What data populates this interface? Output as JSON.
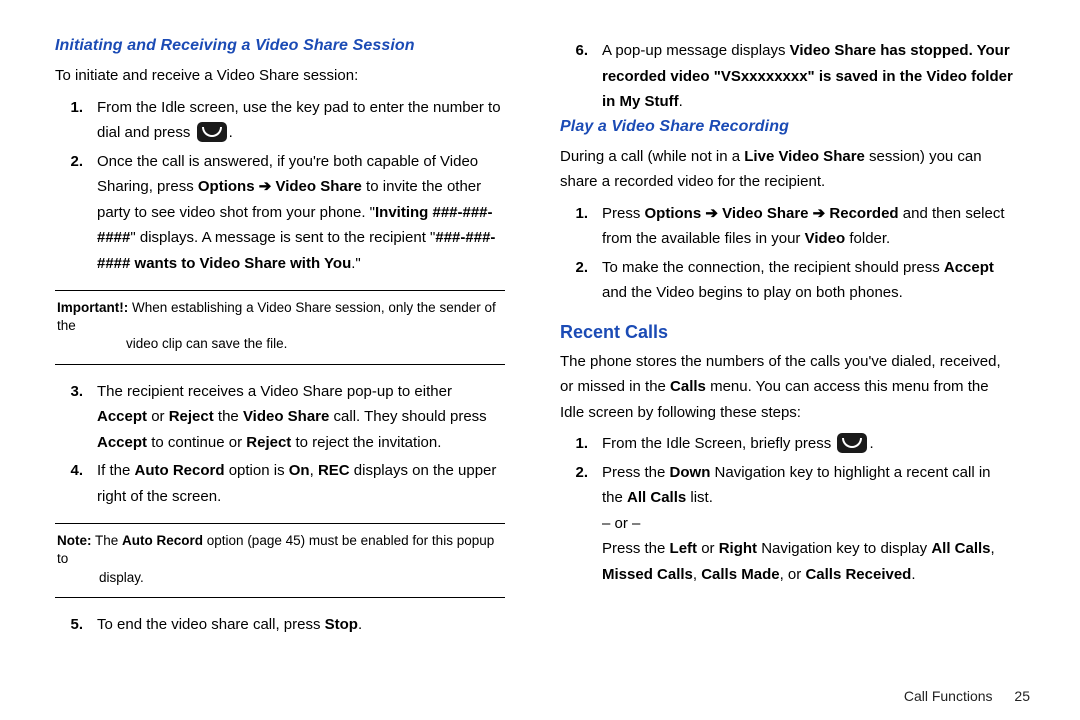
{
  "left": {
    "h_init": "Initiating and Receiving a Video Share Session",
    "intro": "To initiate and receive a Video Share session:",
    "s1_a": "From the Idle screen, use the key pad to enter the number to dial and press ",
    "s1_b": ".",
    "s2_a": "Once the call is answered, if you're both capable of Video Sharing, press ",
    "s2_b": "Options ➔ Video Share",
    "s2_c": " to invite the other party to see video shot from your phone. \"",
    "s2_d": "Inviting ###-###-####",
    "s2_e": "\" displays. A message is sent to the recipient \"",
    "s2_f": "###-###-#### wants to Video Share with You",
    "s2_g": ".\"",
    "important_label": "Important!:",
    "important_1": " When establishing a Video Share session, only the sender of the",
    "important_2": "video clip can save the file.",
    "s3_a": "The recipient receives a Video Share pop-up to either ",
    "s3_b": "Accept",
    "s3_c": " or ",
    "s3_d": "Reject",
    "s3_e": " the ",
    "s3_f": "Video Share",
    "s3_g": " call. They should press ",
    "s3_h": "Accept",
    "s3_i": " to continue or ",
    "s3_j": "Reject",
    "s3_k": " to reject the invitation.",
    "s4_a": "If the ",
    "s4_b": "Auto Record",
    "s4_c": " option is ",
    "s4_d": "On",
    "s4_e": ", ",
    "s4_f": "REC",
    "s4_g": " displays on the upper right of the screen.",
    "note_label": "Note:",
    "note_1": " The ",
    "note_1b": "Auto Record",
    "note_1c": " option (page 45) must be enabled for this popup to",
    "note_2": "display.",
    "s5_a": "To end the video share call, press ",
    "s5_b": "Stop",
    "s5_c": "."
  },
  "right": {
    "s6_a": "A pop-up message displays ",
    "s6_b": "Video Share has stopped. Your recorded video \"VSxxxxxxxx\" is saved in the Video folder in My Stuff",
    "s6_c": ".",
    "h_play": "Play a Video Share Recording",
    "play_intro_a": "During a call (while not in a ",
    "play_intro_b": "Live Video Share",
    "play_intro_c": " session) you can share a recorded video for the recipient.",
    "p1_a": "Press ",
    "p1_b": "Options ➔ Video Share ➔ Recorded",
    "p1_c": " and then select from the available files in your ",
    "p1_d": "Video",
    "p1_e": " folder.",
    "p2_a": "To make the connection, the recipient should press ",
    "p2_b": "Accept",
    "p2_c": " and the Video begins to play on both phones.",
    "h_recent": "Recent Calls",
    "recent_intro_a": "The phone stores the numbers of the calls you've dialed, received, or missed in the ",
    "recent_intro_b": "Calls",
    "recent_intro_c": " menu. You can access this menu from the Idle screen by following these steps:",
    "r1_a": "From the Idle Screen, briefly press ",
    "r1_b": ".",
    "r2_a": "Press the ",
    "r2_b": "Down",
    "r2_c": " Navigation key to highlight a recent call in the ",
    "r2_d": "All Calls",
    "r2_e": " list.",
    "r2_or": "– or –",
    "r2_f": "Press the ",
    "r2_g": "Left",
    "r2_h": " or ",
    "r2_i": "Right",
    "r2_j": " Navigation key to display ",
    "r2_k": "All Calls",
    "r2_l": ", ",
    "r2_m": "Missed Calls",
    "r2_n": ", ",
    "r2_o": "Calls Made",
    "r2_p": ", or ",
    "r2_q": "Calls Received",
    "r2_r": "."
  },
  "footer": {
    "section": "Call Functions",
    "page": "25"
  },
  "nums": {
    "n1": "1.",
    "n2": "2.",
    "n3": "3.",
    "n4": "4.",
    "n5": "5.",
    "n6": "6."
  }
}
